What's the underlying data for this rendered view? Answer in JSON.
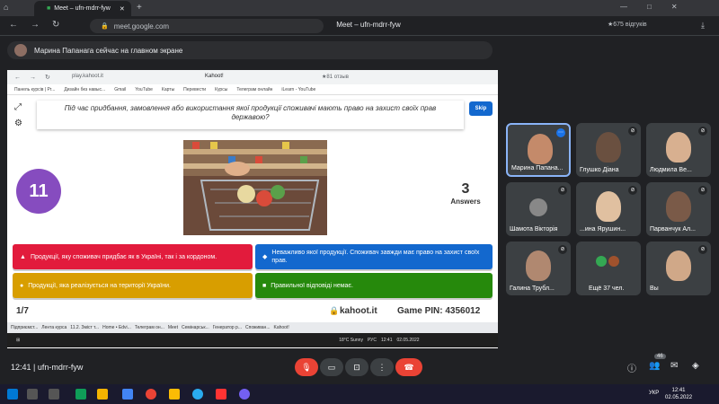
{
  "browser": {
    "tab_title": "Meet – ufn-mdrr-fyw",
    "url": "meet.google.com",
    "window_title": "Meet – ufn-mdrr-fyw",
    "reviews": "★675 відгуків"
  },
  "presenter_banner": "Марина Папанага сейчас на главном экране",
  "shared": {
    "inner_url": "play.kahoot.it",
    "inner_title": "Kahoot!",
    "inner_reviews": "★81 отзыв",
    "bookmarks": [
      "Панель курсів | Pr...",
      "Дизайн без навыс...",
      "Gmail",
      "YouTube",
      "Карты",
      "Перевести",
      "Курсы",
      "Телеграм онлайн",
      "iLearn - YouTube"
    ],
    "question": "Під час придбання, замовлення або використання якої продукції споживачі мають право на захист своїх прав державою?",
    "skip": "Skip",
    "timer": "11",
    "answers_count": "3",
    "answers_label": "Answers",
    "answers": {
      "red": "Продукції, яку споживач придбає як в Україні, так і за кордоном.",
      "blue": "Неважливо якої продукції. Споживач завжди має право на захист своїх прав.",
      "yellow": "Продукції, яка реалізується на території України.",
      "green": "Правильної відповіді немає."
    },
    "progress": "1/7",
    "site": "kahoot.it",
    "pin": "Game PIN: 4356012",
    "taskbar_items": [
      "Підприємст...",
      "Лента курса",
      "11.2. Зміст т...",
      "Home • Edvi...",
      "Телеграм он...",
      "Meet",
      "Семінарськ...",
      "Генератор р...",
      "Споживан...",
      "Kahoot!"
    ],
    "weather": "18°C Sunny",
    "lang": "РУС",
    "inner_time": "12:41",
    "inner_date": "02.05.2022"
  },
  "participants": [
    {
      "name": "Марина Папана..."
    },
    {
      "name": "Глушко Діана"
    },
    {
      "name": "Людмила Ве..."
    },
    {
      "name": "Шамота Вікторія"
    },
    {
      "name": "...ина Ярушин..."
    },
    {
      "name": "Парванчук Ал..."
    },
    {
      "name": "Галина Трубл..."
    },
    {
      "name": "Ещё 37 чел."
    },
    {
      "name": "Вы"
    }
  ],
  "meet": {
    "time_code": "12:41 | ufn-mdrr-fyw",
    "people_badge": "46"
  },
  "taskbar": {
    "lang": "УКР",
    "time": "12:41",
    "date": "02.05.2022"
  }
}
